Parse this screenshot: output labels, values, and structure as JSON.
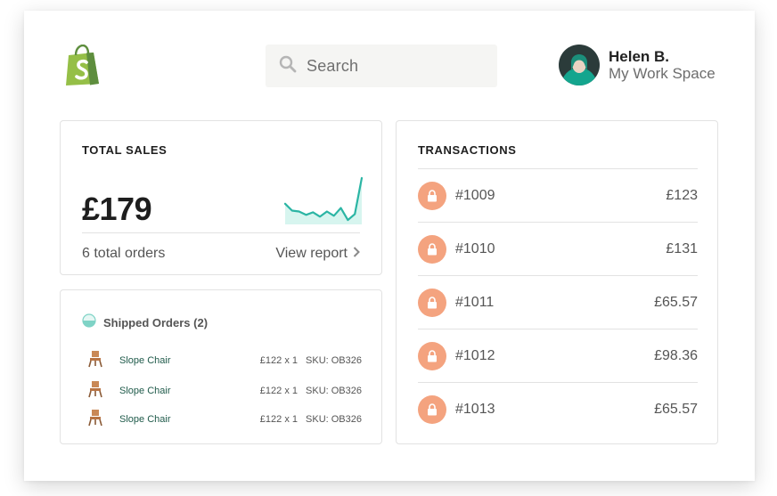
{
  "header": {
    "logo_icon": "shopify-bag-icon",
    "search": {
      "icon": "search-icon",
      "placeholder": "Search"
    },
    "user": {
      "name": "Helen B.",
      "workspace": "My Work Space",
      "avatar_icon": "avatar"
    }
  },
  "sales": {
    "title": "TOTAL SALES",
    "amount": "£179",
    "orders": "6 total orders",
    "link": "View report",
    "chart_data": {
      "type": "area",
      "values": [
        22,
        14,
        13,
        9,
        12,
        7,
        13,
        8,
        17,
        3,
        10,
        52
      ],
      "ylim": [
        0,
        56
      ],
      "grid": false
    }
  },
  "shipped": {
    "title": "Shipped Orders (2)",
    "items": [
      {
        "name": "Slope Chair",
        "price": "£122 x 1",
        "sku": "SKU: OB326"
      },
      {
        "name": "Slope Chair",
        "price": "£122 x 1",
        "sku": "SKU: OB326"
      },
      {
        "name": "Slope Chair",
        "price": "£122 x 1",
        "sku": "SKU: OB326"
      }
    ]
  },
  "transactions": {
    "title": "TRANSACTIONS",
    "items": [
      {
        "id": "#1009",
        "amount": "£123"
      },
      {
        "id": "#1010",
        "amount": "£131"
      },
      {
        "id": "#1011",
        "amount": "£65.57"
      },
      {
        "id": "#1012",
        "amount": "£98.36"
      },
      {
        "id": "#1013",
        "amount": "£65.57"
      }
    ]
  },
  "colors": {
    "brand_green": "#95bf47",
    "spark_line": "#2bb5a4",
    "spark_fill": "#d7f5ef",
    "lock_bg": "#f4a37f",
    "shipped_icon": "#7fd3c6",
    "product_text": "#1f5a4a"
  }
}
